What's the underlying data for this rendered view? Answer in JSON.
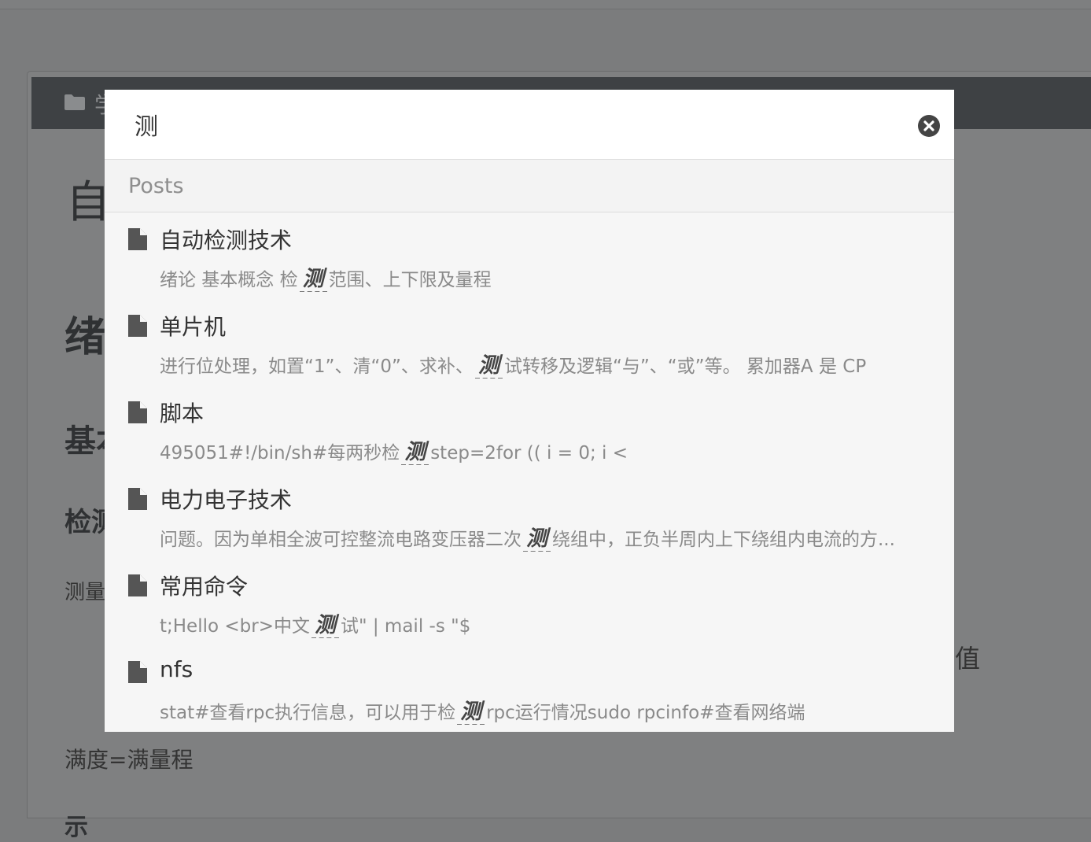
{
  "background": {
    "header_text": "学",
    "h1": "自",
    "h2": "绪",
    "h3": "基本",
    "h4": "检测",
    "p1": "测量",
    "p2": "值",
    "p3": "满度=满量程",
    "h5": "示"
  },
  "search": {
    "query": "测",
    "placeholder": "",
    "close_label": "close"
  },
  "section_title": "Posts",
  "results": [
    {
      "title": "自动检测技术",
      "before": "绪论 基本概念 检",
      "hit": "测",
      "after": "范围、上下限及量程"
    },
    {
      "title": "单片机",
      "before": "进行位处理，如置“1”、清“0”、求补、",
      "hit": "测",
      "after": "试转移及逻辑“与”、“或”等。 累加器A 是 CP"
    },
    {
      "title": "脚本",
      "before": "495051#!/bin/sh#每两秒检",
      "hit": "测",
      "after": "step=2for (( i = 0; i <"
    },
    {
      "title": "电力电子技术",
      "before": "问题。因为单相全波可控整流电路变压器二次",
      "hit": "测",
      "after": "绕组中，正负半周内上下绕组内电流的方..."
    },
    {
      "title": "常用命令",
      "before": "t;Hello <br>中文",
      "hit": "测",
      "after": "试\" | mail -s \"$"
    },
    {
      "title": "nfs",
      "before": "stat#查看rpc执行信息，可以用于检",
      "hit": "测",
      "after": "rpc运行情况sudo rpcinfo#查看网络端"
    }
  ],
  "colors": {
    "overlay": "#7b7c7d",
    "modal_bg": "#f6f6f6",
    "hit_text": "#444444"
  }
}
